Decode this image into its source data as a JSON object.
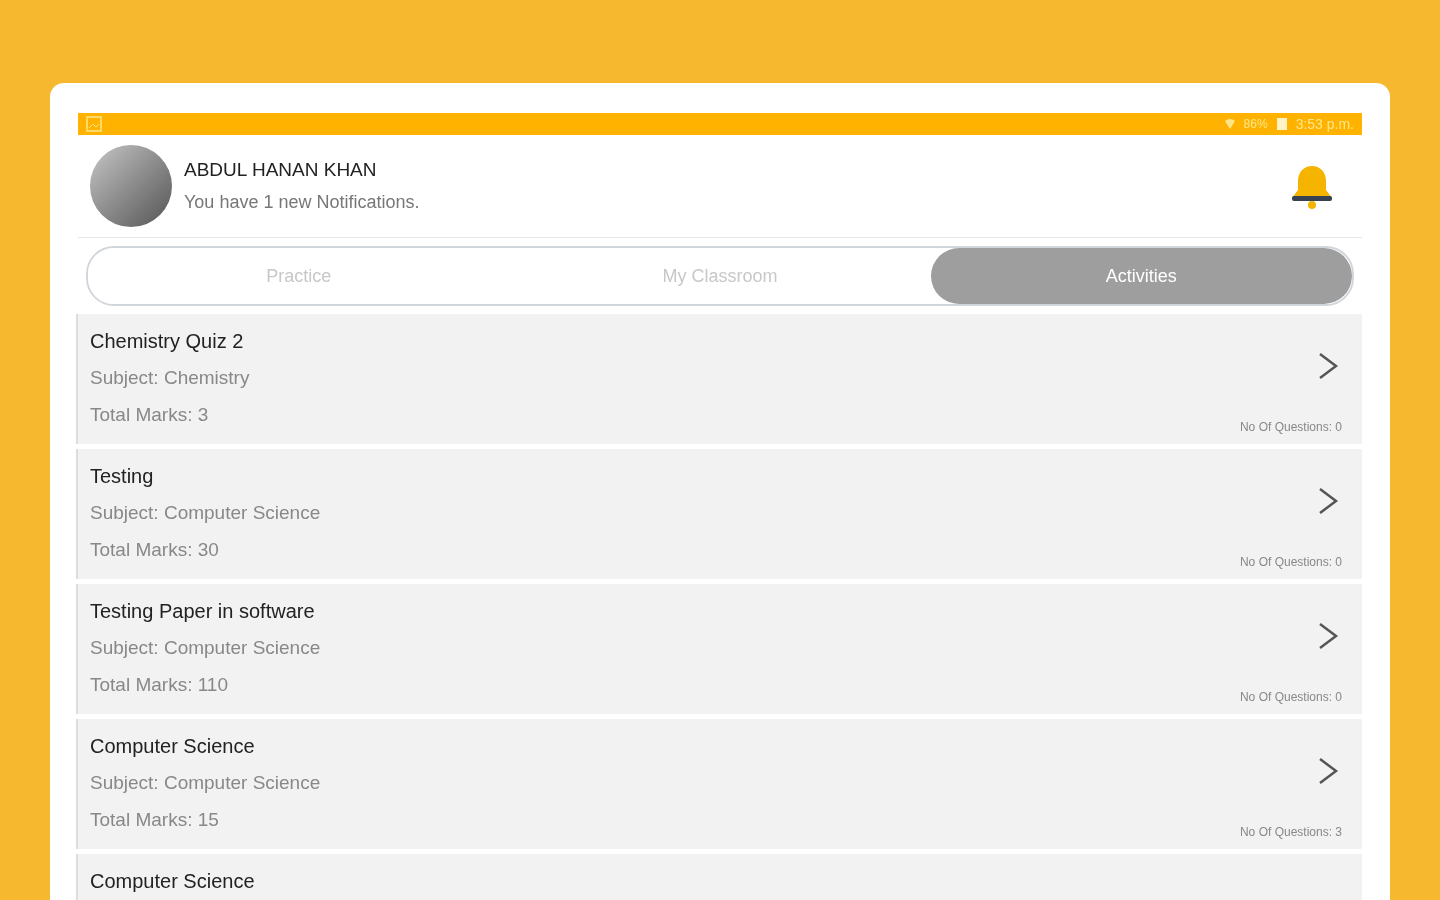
{
  "status_bar": {
    "battery": "86%",
    "time": "3:53 p.m."
  },
  "profile": {
    "name": "ABDUL HANAN KHAN",
    "notice": "You have 1 new Notifications."
  },
  "tabs": [
    {
      "label": "Practice",
      "selected": false
    },
    {
      "label": "My Classroom",
      "selected": false
    },
    {
      "label": "Activities",
      "selected": true
    }
  ],
  "activities": [
    {
      "title": "Chemistry Quiz 2",
      "subject": "Subject: Chemistry",
      "marks": "Total Marks: 3",
      "questions": "No Of Questions: 0"
    },
    {
      "title": "Testing",
      "subject": "Subject: Computer Science",
      "marks": "Total Marks: 30",
      "questions": "No Of Questions: 0"
    },
    {
      "title": "Testing Paper in software",
      "subject": "Subject: Computer Science",
      "marks": "Total Marks: 110",
      "questions": "No Of Questions: 0"
    },
    {
      "title": "Computer Science",
      "subject": "Subject: Computer Science",
      "marks": "Total Marks: 15",
      "questions": "No Of Questions: 3"
    },
    {
      "title": "Computer Science"
    }
  ]
}
